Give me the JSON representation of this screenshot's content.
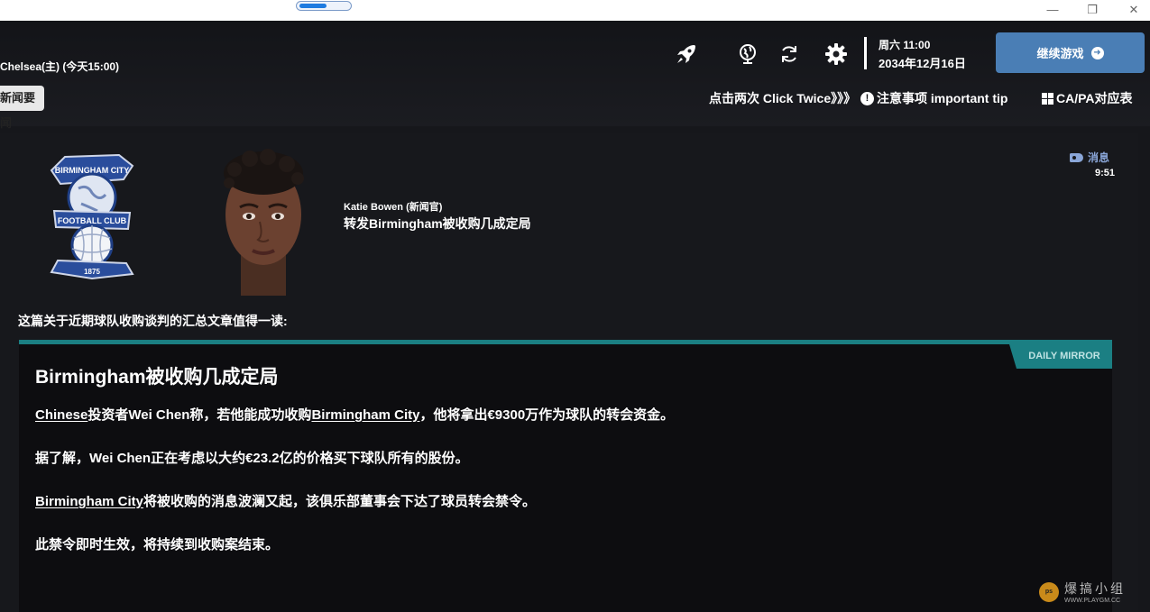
{
  "header": {
    "match": "Chelsea(主) (今天15:00)",
    "news_button": "新闻要闻",
    "date_line1": "周六 11:00",
    "date_line2": "2034年12月16日",
    "continue_label": "继续游戏",
    "tip_click_twice": "点击两次 Click Twice》》》",
    "tip_important": "注意事项 important tip",
    "tip_capa": "CA/PA对应表",
    "icons": [
      "rocket-icon",
      "globe-icon",
      "refresh-icon",
      "gear-icon"
    ]
  },
  "message": {
    "sender": "Katie Bowen (新闻官)",
    "subject": "转发Birmingham被收购几成定局",
    "tag": "消息",
    "time": "9:51",
    "intro": "这篇关于近期球队收购谈判的汇总文章值得一读:"
  },
  "crest": {
    "top_text": "BIRMINGHAM CITY",
    "band_text": "FOOTBALL CLUB",
    "year": "1875"
  },
  "article": {
    "source": "DAILY MIRROR",
    "title": "Birmingham被收购几成定局",
    "p1": {
      "link1": "Chinese",
      "text1": "投资者Wei Chen称，若他能成功收购",
      "link2": "Birmingham City",
      "text2": "，他将拿出€9300万作为球队的转会资金。"
    },
    "p2": "据了解，Wei Chen正在考虑以大约€23.2亿的价格买下球队所有的股份。",
    "p3": {
      "link": "Birmingham City",
      "text": "将被收购的消息波澜又起，该俱乐部董事会下达了球员转会禁令。"
    },
    "p4": "此禁令即时生效，将持续到收购案结束。"
  },
  "watermark": {
    "logo": "ps",
    "text": "爆搞小组",
    "url": "WWW.PLAYGM.CC"
  },
  "colors": {
    "accent_teal": "#1b7f83",
    "continue_blue": "#4a7eb5",
    "tag_blue": "#8aa6d8"
  }
}
